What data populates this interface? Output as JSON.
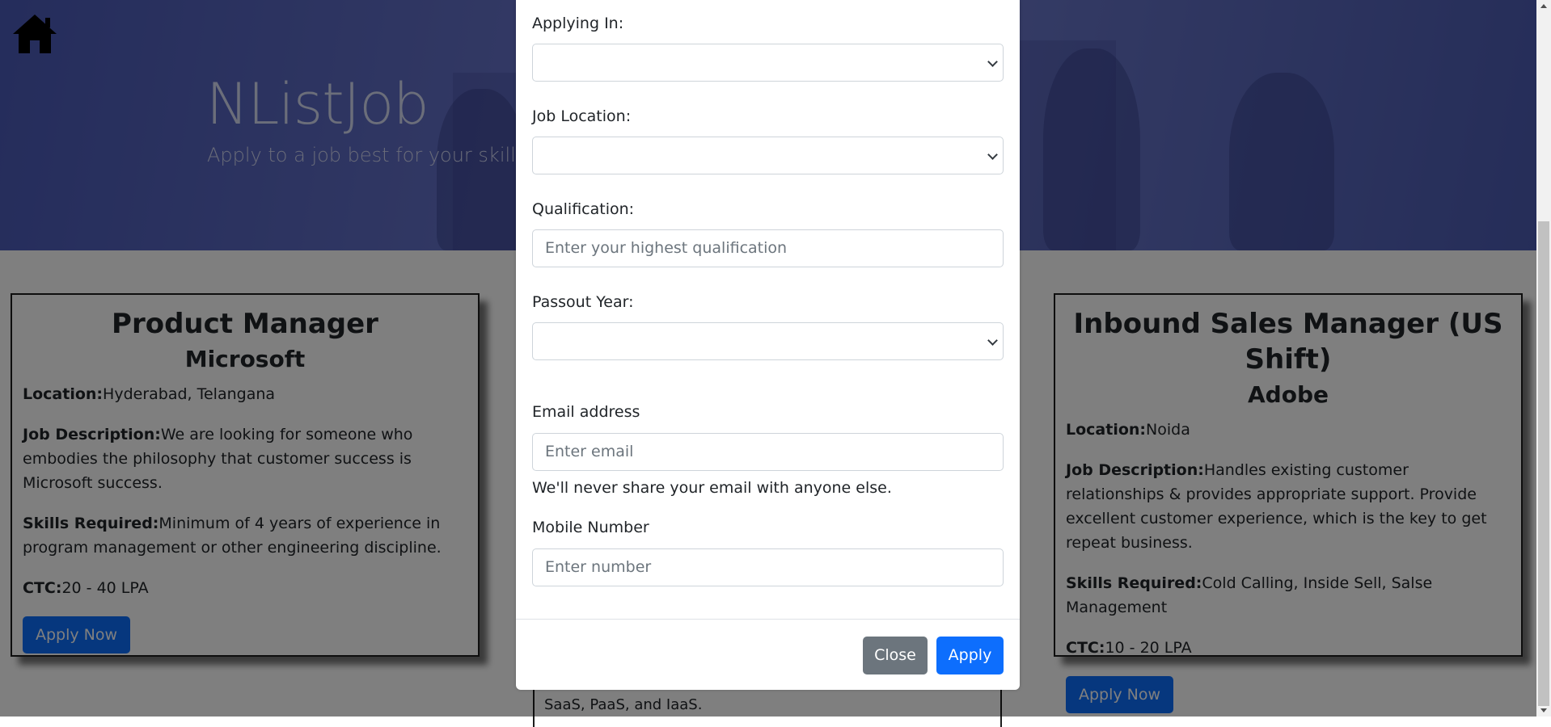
{
  "hero": {
    "title": "NListJob",
    "subtitle": "Apply to a job best for your skills here"
  },
  "jobs": [
    {
      "title": "Product Manager",
      "company": "Microsoft",
      "location_label": "Location:",
      "location": "Hyderabad, Telangana",
      "description_label": "Job Description:",
      "description": "We are looking for someone who embodies the philosophy that customer success is Microsoft success.",
      "skills_label": "Skills Required:",
      "skills": "Minimum of 4 years of experience in program management or other engineering discipline.",
      "ctc_label": "CTC:",
      "ctc": "20 - 40 LPA",
      "apply_label": "Apply Now"
    },
    {
      "title": "Inbound Sales Manager (US Shift)",
      "company": "Adobe",
      "location_label": "Location:",
      "location": "Noida",
      "description_label": "Job Description:",
      "description": "Handles existing customer relationships & provides appropriate support. Provide excellent customer experience, which is the key to get repeat business.",
      "skills_label": "Skills Required:",
      "skills": "Cold Calling, Inside Sell, Salse Management",
      "ctc_label": "CTC:",
      "ctc": "10 - 20 LPA",
      "apply_label": "Apply Now"
    }
  ],
  "middle_card_partial_text": "SaaS, PaaS, and IaaS.",
  "modal": {
    "applying_in_label": "Applying In:",
    "applying_in_value": "",
    "job_location_label": "Job Location:",
    "job_location_value": "",
    "qualification_label": "Qualification:",
    "qualification_placeholder": "Enter your highest qualification",
    "passout_year_label": "Passout Year:",
    "passout_year_value": "",
    "email_label": "Email address",
    "email_placeholder": "Enter email",
    "email_help": "We'll never share your email with anyone else.",
    "mobile_label": "Mobile Number",
    "mobile_placeholder": "Enter number",
    "close_label": "Close",
    "apply_label": "Apply"
  },
  "colors": {
    "primary": "#0d6efd",
    "secondary": "#6c757d",
    "hero": "#5b68c0"
  }
}
